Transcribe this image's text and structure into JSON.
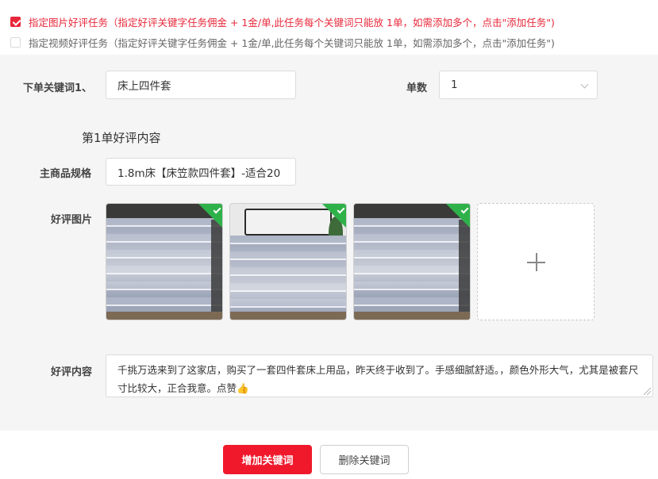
{
  "task_options": [
    {
      "label": "指定图片好评任务（指定好评关键字任务佣金 + 1金/单,此任务每个关键词只能放 1单，如需添加多个，点击\"添加任务\")",
      "checked": true
    },
    {
      "label": "指定视频好评任务（指定好评关键字任务佣金 + 1金/单,此任务每个关键词只能放 1单，如需添加多个，点击\"添加任务\")",
      "checked": false
    }
  ],
  "form": {
    "keyword_label": "下单关键词1、",
    "keyword_value": "床上四件套",
    "quantity_label": "单数",
    "quantity_value": "1",
    "section_title": "第1单好评内容",
    "spec_label": "主商品规格",
    "spec_value": "1.8m床【床笠款四件套】-适合20",
    "photos_label": "好评图片",
    "photos": [
      {
        "alt": "床上四件套实拍图1",
        "selected": true
      },
      {
        "alt": "床上四件套实拍图2",
        "selected": true
      },
      {
        "alt": "床上四件套实拍图3",
        "selected": true
      }
    ],
    "review_label": "好评内容",
    "review_text": "千挑万选来到了这家店，购买了一套四件套床上用品，昨天终于收到了。手感细腻舒适。，颜色外形大气，尤其是被套尺寸比较大，正合我意。点赞👍"
  },
  "actions": {
    "add_keyword": "增加关键词",
    "remove_keyword": "删除关键词"
  },
  "colors": {
    "accent": "#f0192c",
    "option_red": "#e8283a",
    "check_green": "#2fb14a",
    "panel_bg": "#f5f5f5"
  }
}
